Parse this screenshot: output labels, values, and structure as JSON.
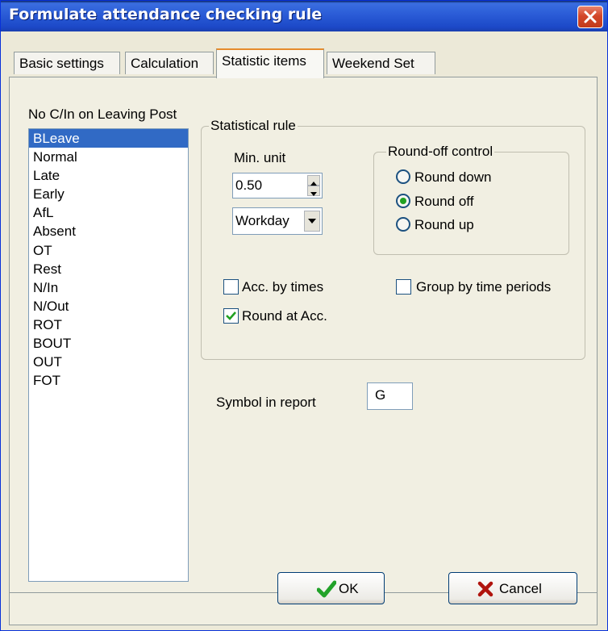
{
  "window": {
    "title": "Formulate attendance checking rule"
  },
  "tabs": [
    "Basic settings",
    "Calculation",
    "Statistic items",
    "Weekend Set"
  ],
  "list": {
    "label": "No C/In on Leaving Post",
    "items": [
      "BLeave",
      "Normal",
      "Late",
      "Early",
      "AfL",
      "Absent",
      "OT",
      "Rest",
      "N/In",
      "N/Out",
      "ROT",
      "BOUT",
      "OUT",
      "FOT"
    ],
    "selected": "BLeave"
  },
  "statistical_rule": {
    "title": "Statistical rule",
    "min_unit_label": "Min. unit",
    "min_unit_value": "0.50",
    "unit_select_value": "Workday"
  },
  "round_off": {
    "title": "Round-off control",
    "options": [
      "Round down",
      "Round off",
      "Round up"
    ],
    "selected": "Round off"
  },
  "checkboxes": {
    "acc_by_times": {
      "label": "Acc. by times",
      "checked": false
    },
    "round_at_acc": {
      "label": "Round at Acc.",
      "checked": true
    },
    "group_by_time": {
      "label": "Group by time periods",
      "checked": false
    }
  },
  "symbol": {
    "label": "Symbol in report",
    "value": "G"
  },
  "buttons": {
    "ok": "OK",
    "cancel": "Cancel"
  },
  "colors": {
    "title_bar": "#2C5ED8",
    "selection": "#316AC5",
    "tab_accent": "#E68B2C",
    "panel": "#F1EFE2"
  }
}
